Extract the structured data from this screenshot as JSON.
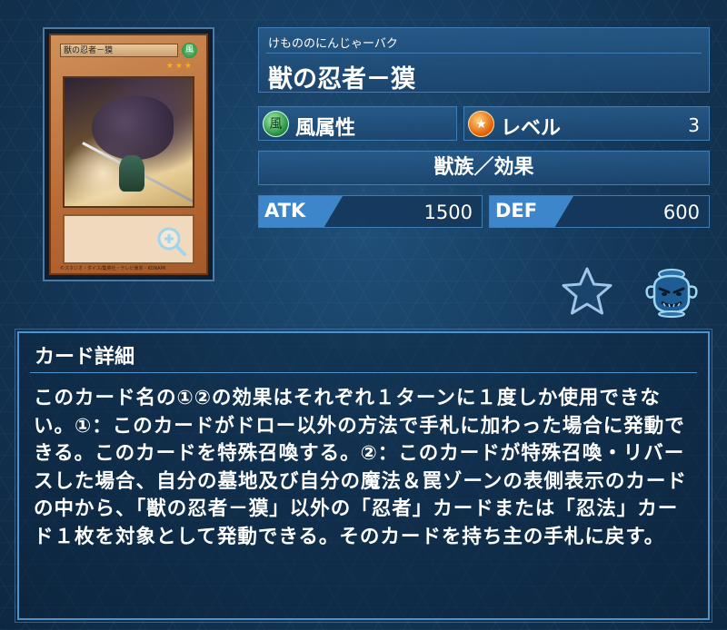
{
  "card_image": {
    "name_on_card": "獣の忍者－獏",
    "attribute_glyph": "風",
    "level_stars": "★★★",
    "copyright": "©スタジオ・ダイス/集英社・テレビ東京・KONAMI",
    "zoom_icon": "magnifier-plus-icon"
  },
  "header": {
    "ruby": "けもののにんじゃーバク",
    "card_name": "獣の忍者－獏"
  },
  "attribute": {
    "icon_glyph": "風",
    "label": "風属性"
  },
  "level": {
    "icon_glyph": "★",
    "label": "レベル",
    "value": "3"
  },
  "type_line": "獣族／効果",
  "stats": {
    "atk_label": "ATK",
    "atk_value": "1500",
    "def_label": "DEF",
    "def_value": "600"
  },
  "actions": {
    "favorite_icon": "star-outline-icon",
    "deck_icon": "pot-of-greed-icon"
  },
  "detail": {
    "title": "カード詳細",
    "text": "このカード名の①②の効果はそれぞれ１ターンに１度しか使用できない。①：このカードがドロー以外の方法で手札に加わった場合に発動できる。このカードを特殊召喚する。②：このカードが特殊召喚・リバースした場合、自分の墓地及び自分の魔法＆罠ゾーンの表側表示のカードの中から、「獣の忍者－獏」以外の「忍者」カードまたは「忍法」カード１枚を対象として発動できる。そのカードを持ち主の手札に戻す。"
  },
  "colors": {
    "background": "#153a5c",
    "panel": "#24578a",
    "panel_border": "#3f7db4",
    "stat_tag": "#3d86cc",
    "card_frame_effect": "#b86a34"
  }
}
